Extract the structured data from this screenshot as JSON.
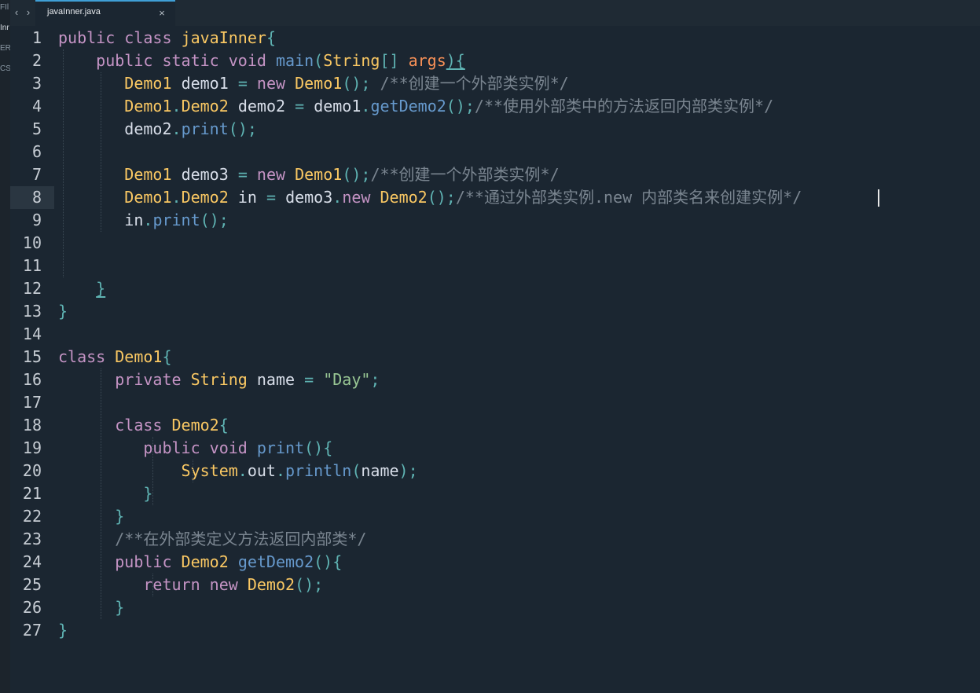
{
  "sidebar": {
    "items": [
      {
        "label": "FIl",
        "active": false
      },
      {
        "label": "Inr",
        "active": true
      },
      {
        "label": "ERS",
        "active": false
      },
      {
        "label": "CS",
        "active": false
      }
    ]
  },
  "tabbar": {
    "back_icon": "‹",
    "forward_icon": "›",
    "tabs": [
      {
        "label": "javaInner.java",
        "close_icon": "×",
        "active": true
      }
    ]
  },
  "editor": {
    "current_line": 8,
    "lines": [
      {
        "n": "1",
        "tokens": [
          [
            "kw",
            "public"
          ],
          [
            "plain",
            " "
          ],
          [
            "kw",
            "class"
          ],
          [
            "plain",
            " "
          ],
          [
            "cls",
            "javaInner"
          ],
          [
            "punc",
            "{"
          ]
        ]
      },
      {
        "n": "2",
        "tokens": [
          [
            "plain",
            "    "
          ],
          [
            "kw",
            "public"
          ],
          [
            "plain",
            " "
          ],
          [
            "kw",
            "static"
          ],
          [
            "plain",
            " "
          ],
          [
            "kw",
            "void"
          ],
          [
            "plain",
            " "
          ],
          [
            "fn",
            "main"
          ],
          [
            "punc",
            "("
          ],
          [
            "cls",
            "String"
          ],
          [
            "punc",
            "[]"
          ],
          [
            "plain",
            " "
          ],
          [
            "param",
            "args"
          ],
          [
            "punc",
            "){"
          ]
        ]
      },
      {
        "n": "3",
        "tokens": [
          [
            "plain",
            "       "
          ],
          [
            "cls",
            "Demo1"
          ],
          [
            "plain",
            " "
          ],
          [
            "id",
            "demo1"
          ],
          [
            "plain",
            " "
          ],
          [
            "op",
            "="
          ],
          [
            "plain",
            " "
          ],
          [
            "kw",
            "new"
          ],
          [
            "plain",
            " "
          ],
          [
            "cls",
            "Demo1"
          ],
          [
            "punc",
            "();"
          ],
          [
            "plain",
            " "
          ],
          [
            "cmt",
            "/**创建一个外部类实例*/"
          ]
        ]
      },
      {
        "n": "4",
        "tokens": [
          [
            "plain",
            "       "
          ],
          [
            "cls",
            "Demo1"
          ],
          [
            "punc",
            "."
          ],
          [
            "cls",
            "Demo2"
          ],
          [
            "plain",
            " "
          ],
          [
            "id",
            "demo2"
          ],
          [
            "plain",
            " "
          ],
          [
            "op",
            "="
          ],
          [
            "plain",
            " "
          ],
          [
            "id",
            "demo1"
          ],
          [
            "punc",
            "."
          ],
          [
            "fn",
            "getDemo2"
          ],
          [
            "punc",
            "();"
          ],
          [
            "cmt",
            "/**使用外部类中的方法返回内部类实例*/"
          ]
        ]
      },
      {
        "n": "5",
        "tokens": [
          [
            "plain",
            "       "
          ],
          [
            "id",
            "demo2"
          ],
          [
            "punc",
            "."
          ],
          [
            "fn",
            "print"
          ],
          [
            "punc",
            "();"
          ]
        ]
      },
      {
        "n": "6",
        "tokens": []
      },
      {
        "n": "7",
        "tokens": [
          [
            "plain",
            "       "
          ],
          [
            "cls",
            "Demo1"
          ],
          [
            "plain",
            " "
          ],
          [
            "id",
            "demo3"
          ],
          [
            "plain",
            " "
          ],
          [
            "op",
            "="
          ],
          [
            "plain",
            " "
          ],
          [
            "kw",
            "new"
          ],
          [
            "plain",
            " "
          ],
          [
            "cls",
            "Demo1"
          ],
          [
            "punc",
            "();"
          ],
          [
            "cmt",
            "/**创建一个外部类实例*/"
          ]
        ]
      },
      {
        "n": "8",
        "tokens": [
          [
            "plain",
            "       "
          ],
          [
            "cls",
            "Demo1"
          ],
          [
            "punc",
            "."
          ],
          [
            "cls",
            "Demo2"
          ],
          [
            "plain",
            " "
          ],
          [
            "id",
            "in"
          ],
          [
            "plain",
            " "
          ],
          [
            "op",
            "="
          ],
          [
            "plain",
            " "
          ],
          [
            "id",
            "demo3"
          ],
          [
            "punc",
            "."
          ],
          [
            "kw",
            "new"
          ],
          [
            "plain",
            " "
          ],
          [
            "cls",
            "Demo2"
          ],
          [
            "punc",
            "();"
          ],
          [
            "cmt",
            "/**通过外部类实例.new 内部类名来创建实例*/"
          ]
        ]
      },
      {
        "n": "9",
        "tokens": [
          [
            "plain",
            "       "
          ],
          [
            "id",
            "in"
          ],
          [
            "punc",
            "."
          ],
          [
            "fn",
            "print"
          ],
          [
            "punc",
            "();"
          ]
        ]
      },
      {
        "n": "10",
        "tokens": []
      },
      {
        "n": "11",
        "tokens": []
      },
      {
        "n": "12",
        "tokens": [
          [
            "plain",
            "    "
          ],
          [
            "punc",
            "}"
          ]
        ]
      },
      {
        "n": "13",
        "tokens": [
          [
            "punc",
            "}"
          ]
        ]
      },
      {
        "n": "14",
        "tokens": []
      },
      {
        "n": "15",
        "tokens": [
          [
            "kw",
            "class"
          ],
          [
            "plain",
            " "
          ],
          [
            "cls",
            "Demo1"
          ],
          [
            "punc",
            "{"
          ]
        ]
      },
      {
        "n": "16",
        "tokens": [
          [
            "plain",
            "      "
          ],
          [
            "kw",
            "private"
          ],
          [
            "plain",
            " "
          ],
          [
            "cls",
            "String"
          ],
          [
            "plain",
            " "
          ],
          [
            "id",
            "name"
          ],
          [
            "plain",
            " "
          ],
          [
            "op",
            "="
          ],
          [
            "plain",
            " "
          ],
          [
            "str",
            "\"Day\""
          ],
          [
            "punc",
            ";"
          ]
        ]
      },
      {
        "n": "17",
        "tokens": []
      },
      {
        "n": "18",
        "tokens": [
          [
            "plain",
            "      "
          ],
          [
            "kw",
            "class"
          ],
          [
            "plain",
            " "
          ],
          [
            "cls",
            "Demo2"
          ],
          [
            "punc",
            "{"
          ]
        ]
      },
      {
        "n": "19",
        "tokens": [
          [
            "plain",
            "         "
          ],
          [
            "kw",
            "public"
          ],
          [
            "plain",
            " "
          ],
          [
            "kw",
            "void"
          ],
          [
            "plain",
            " "
          ],
          [
            "fn",
            "print"
          ],
          [
            "punc",
            "(){"
          ]
        ]
      },
      {
        "n": "20",
        "tokens": [
          [
            "plain",
            "             "
          ],
          [
            "cls",
            "System"
          ],
          [
            "punc",
            "."
          ],
          [
            "id",
            "out"
          ],
          [
            "punc",
            "."
          ],
          [
            "fn",
            "println"
          ],
          [
            "punc",
            "("
          ],
          [
            "id",
            "name"
          ],
          [
            "punc",
            ");"
          ]
        ]
      },
      {
        "n": "21",
        "tokens": [
          [
            "plain",
            "         "
          ],
          [
            "punc",
            "}"
          ]
        ]
      },
      {
        "n": "22",
        "tokens": [
          [
            "plain",
            "      "
          ],
          [
            "punc",
            "}"
          ]
        ]
      },
      {
        "n": "23",
        "tokens": [
          [
            "plain",
            "      "
          ],
          [
            "cmt",
            "/**在外部类定义方法返回内部类*/"
          ]
        ]
      },
      {
        "n": "24",
        "tokens": [
          [
            "plain",
            "      "
          ],
          [
            "kw",
            "public"
          ],
          [
            "plain",
            " "
          ],
          [
            "cls",
            "Demo2"
          ],
          [
            "plain",
            " "
          ],
          [
            "fn",
            "getDemo2"
          ],
          [
            "punc",
            "(){"
          ]
        ]
      },
      {
        "n": "25",
        "tokens": [
          [
            "plain",
            "         "
          ],
          [
            "kw",
            "return"
          ],
          [
            "plain",
            " "
          ],
          [
            "kw",
            "new"
          ],
          [
            "plain",
            " "
          ],
          [
            "cls",
            "Demo2"
          ],
          [
            "punc",
            "();"
          ]
        ]
      },
      {
        "n": "26",
        "tokens": [
          [
            "plain",
            "      "
          ],
          [
            "punc",
            "}"
          ]
        ]
      },
      {
        "n": "27",
        "tokens": [
          [
            "punc",
            "}"
          ]
        ]
      }
    ]
  },
  "colors": {
    "background": "#1b2631",
    "keyword": "#c594c5",
    "class": "#fac863",
    "function": "#6699cc",
    "punctuation": "#5fb3b3",
    "string": "#99c794",
    "comment": "#7a8590",
    "parameter": "#f99157",
    "tab_accent": "#3f9fd6"
  }
}
